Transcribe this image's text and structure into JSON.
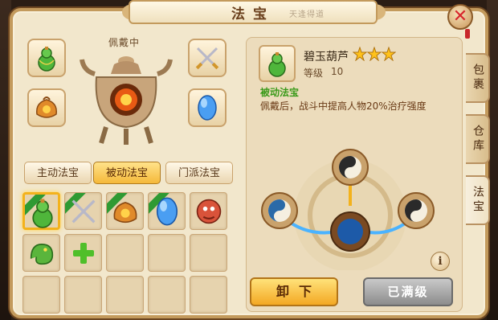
{
  "window": {
    "title": "法宝",
    "title_deco": "天逢得道"
  },
  "equipped": {
    "label": "佩戴中",
    "slots": [
      {
        "icon": "green-gourd-icon"
      },
      {
        "icon": "crossed-swords-icon"
      },
      {
        "icon": "fire-bag-icon"
      },
      {
        "icon": "blue-crystal-icon"
      }
    ]
  },
  "tabs": [
    {
      "label": "主动法宝",
      "active": false
    },
    {
      "label": "被动法宝",
      "active": true
    },
    {
      "label": "门派法宝",
      "active": false
    }
  ],
  "inventory": {
    "items": [
      {
        "icon": "green-gourd-icon",
        "tag": "已装备",
        "selected": true
      },
      {
        "icon": "crossed-swords-icon",
        "tag": "已装备",
        "selected": false
      },
      {
        "icon": "fire-bag-icon",
        "tag": "已装备",
        "selected": false
      },
      {
        "icon": "blue-crystal-icon",
        "tag": "已装备",
        "selected": false
      },
      {
        "icon": "red-lion-icon",
        "tag": "",
        "selected": false
      },
      {
        "icon": "green-dragon-icon",
        "tag": "",
        "selected": false
      },
      {
        "icon": "add-slot-icon",
        "tag": "",
        "selected": false
      }
    ],
    "total_slots": 15
  },
  "detail": {
    "name": "碧玉葫芦",
    "stars": 3,
    "level_label": "等级",
    "level_value": "10",
    "type": "被动法宝",
    "description": "佩戴后，战斗中提高人物20%治疗强度"
  },
  "buttons": {
    "unload": "卸下",
    "maxed": "已满级",
    "info": "i"
  },
  "side_tabs": [
    {
      "label": "包裹",
      "active": false
    },
    {
      "label": "仓库",
      "active": false
    },
    {
      "label": "法宝",
      "active": true
    }
  ],
  "colors": {
    "accent": "#f5b93a",
    "frame": "#c39a5c",
    "passive_green": "#3a9a1a",
    "close_red": "#d7262c"
  }
}
